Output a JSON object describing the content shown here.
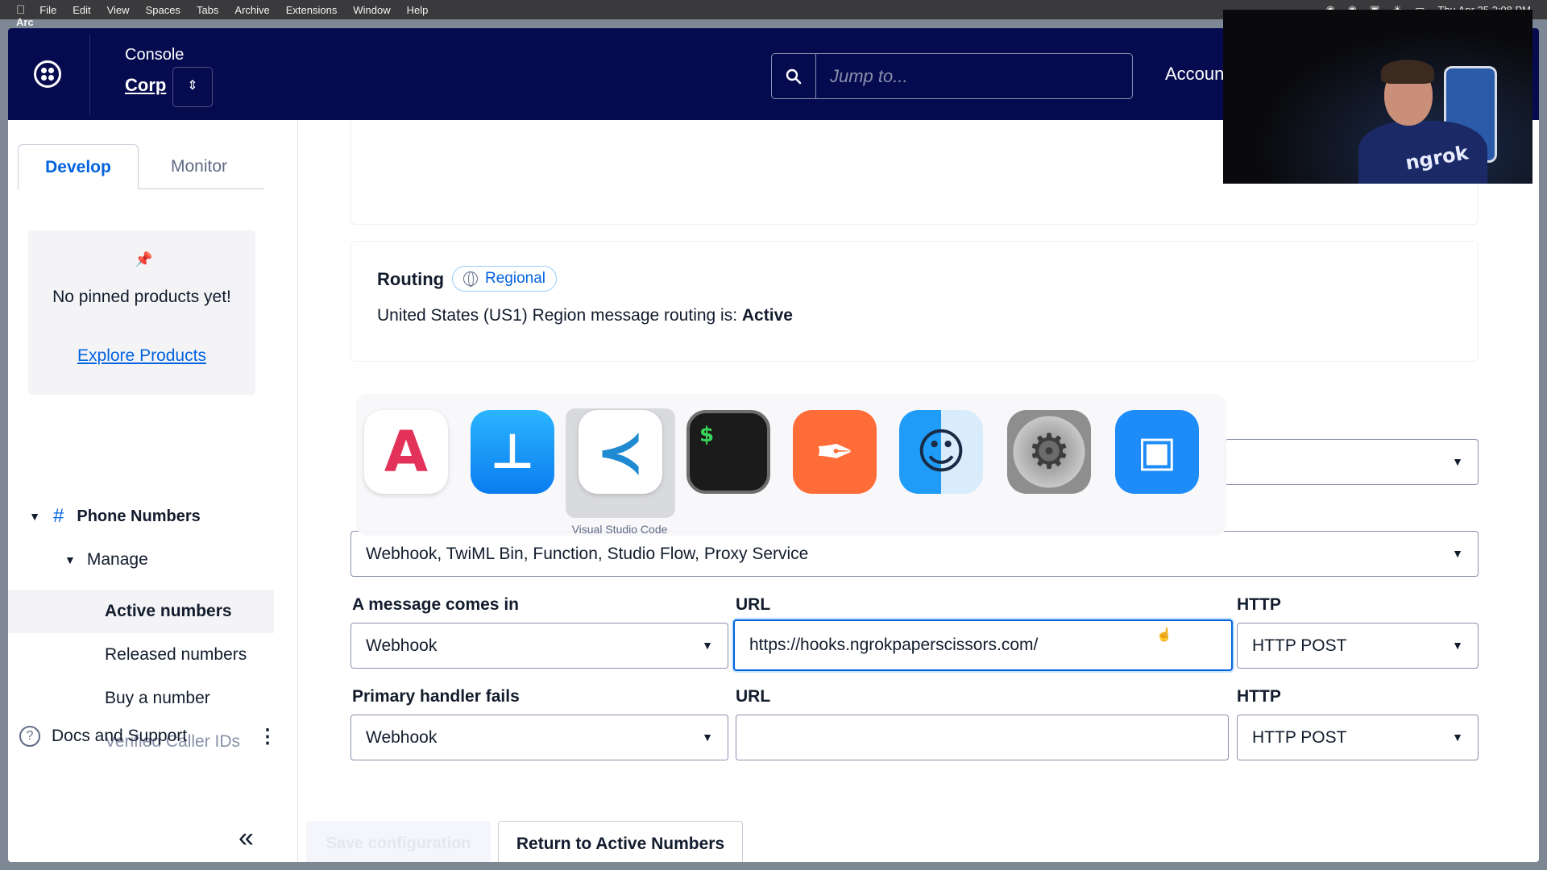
{
  "menubar": {
    "app": "Arc",
    "items": [
      "File",
      "Edit",
      "View",
      "Spaces",
      "Tabs",
      "Archive",
      "Extensions",
      "Window",
      "Help"
    ],
    "clock": "Thu Apr 25 2:08 PM"
  },
  "header": {
    "console_label": "Console",
    "account_name": "Corp",
    "search_placeholder": "Jump to...",
    "account_label": "Accoun"
  },
  "webcam": {
    "shirt_text": "ngrok"
  },
  "sidebar": {
    "tabs": {
      "develop": "Develop",
      "monitor": "Monitor"
    },
    "pinned_text": "No pinned products yet!",
    "explore_link": "Explore Products",
    "section": "Phone Numbers",
    "subsection": "Manage",
    "items": [
      "Active numbers",
      "Released numbers",
      "Buy a number",
      "Verified Caller IDs"
    ],
    "docs": "Docs and Support"
  },
  "routing": {
    "label": "Routing",
    "badge": "Regional",
    "text": "United States (US1) Region message routing is: ",
    "status": "Active"
  },
  "config": {
    "service_select": "Webhook, TwiML Bin, Function, Studio Flow, Proxy Service",
    "message_in_label": "A message comes in",
    "message_in_select": "Webhook",
    "url_label": "URL",
    "url_value": "https://hooks.ngrokpaperscissors.com/",
    "http_label": "HTTP",
    "http_select": "HTTP POST",
    "fail_label": "Primary handler fails",
    "fail_select": "Webhook",
    "fail_url_value": "",
    "fail_http_select": "HTTP POST"
  },
  "actions": {
    "save": "Save configuration",
    "return": "Return to Active Numbers"
  },
  "app_switcher": {
    "selected_label": "Visual Studio Code",
    "terminal_glyph": "$"
  }
}
